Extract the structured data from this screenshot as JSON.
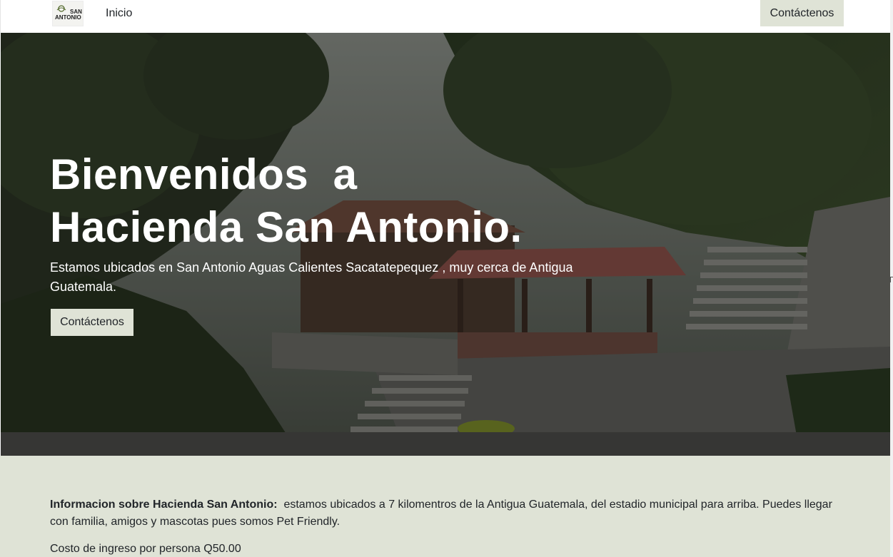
{
  "navbar": {
    "logo_text": "SAN ANTONIO",
    "links": [
      {
        "label": "Inicio"
      }
    ],
    "cta_label": "Contáctenos"
  },
  "hero": {
    "title_line1": "Bienvenidos  a",
    "title_line2": "Hacienda San Antonio.",
    "subtitle": "Estamos ubicados en San Antonio Aguas Calientes Sacatatepequez , muy cerca de Antigua Guatemala.",
    "cta_label": "Contáctenos"
  },
  "info": {
    "heading": "Informacion sobre Hacienda San Antonio:",
    "body": "estamos ubicados a 7 kilomentros de la Antigua Guatemala, del estadio municipal para arriba. Puedes llegar con familia, amigos y mascotas pues somos Pet Friendly.",
    "price": "Costo de ingreso por persona Q50.00"
  },
  "colors": {
    "accent": "#dfe3d6",
    "text": "#212529",
    "hero_text": "#ffffff"
  }
}
